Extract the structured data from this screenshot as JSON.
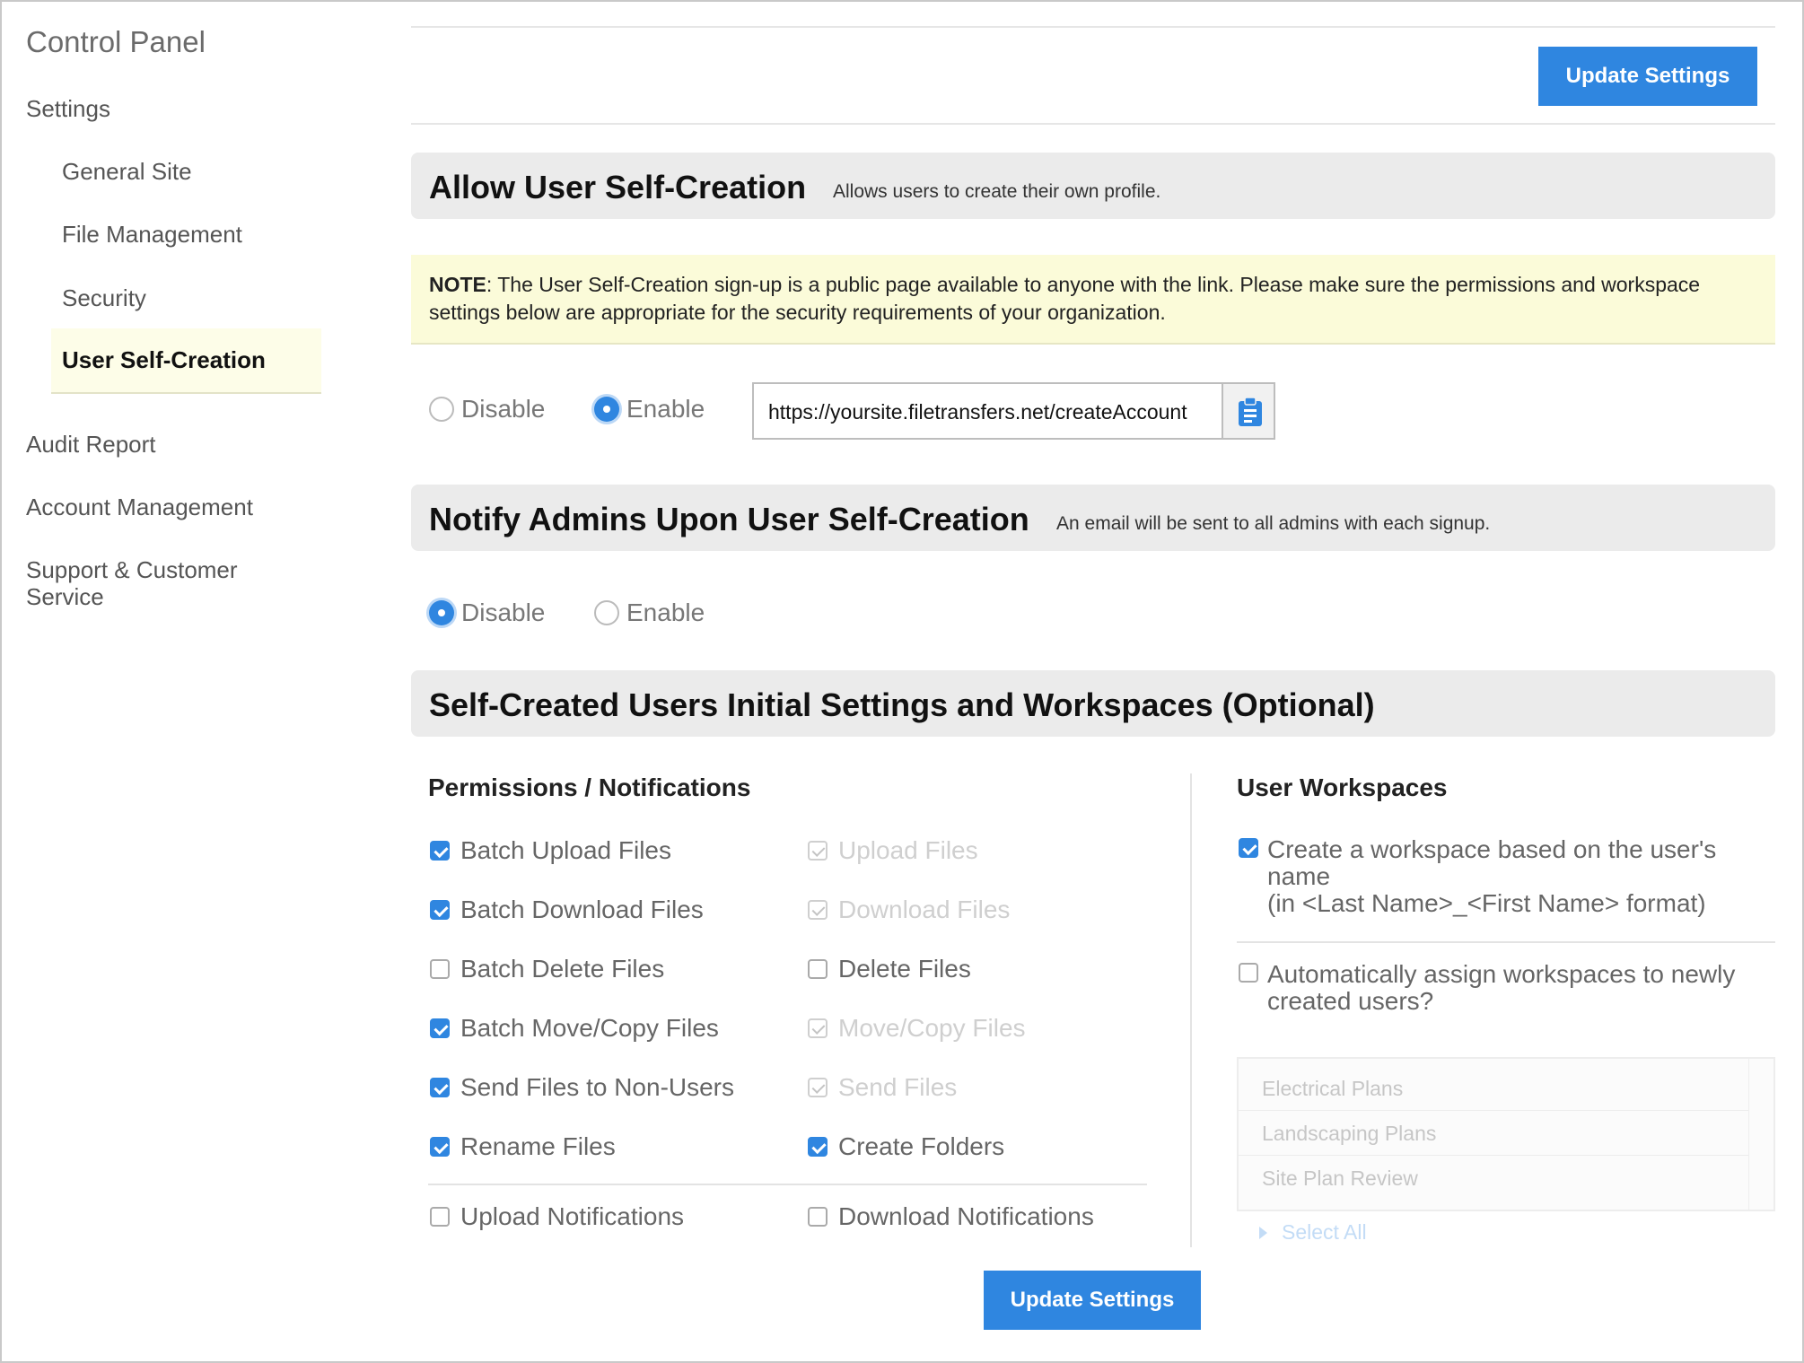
{
  "sidebar": {
    "title": "Control Panel",
    "settings_label": "Settings",
    "sub_items": [
      "General Site",
      "File Management",
      "Security",
      "User Self-Creation"
    ],
    "items": [
      "Audit Report",
      "Account Management",
      "Support & Customer Service"
    ]
  },
  "toolbar": {
    "update_label": "Update Settings"
  },
  "allow_section": {
    "title": "Allow User Self-Creation",
    "description": "Allows users to create their own profile.",
    "note_label": "NOTE",
    "note_text": ": The User Self-Creation sign-up is a public page available to anyone with the link. Please make sure the permissions and workspace settings below are appropriate for the security requirements of your organization.",
    "disable_label": "Disable",
    "enable_label": "Enable",
    "selected": "Enable",
    "url_value": "https://yoursite.filetransfers.net/createAccount"
  },
  "notify_section": {
    "title": "Notify Admins Upon User Self-Creation",
    "description": "An email will be sent to all admins with each signup.",
    "disable_label": "Disable",
    "enable_label": "Enable",
    "selected": "Disable"
  },
  "initial_section": {
    "title": "Self-Created Users Initial Settings and Workspaces (Optional)",
    "permissions_heading": "Permissions / Notifications",
    "permissions_left": [
      {
        "label": "Batch Upload Files",
        "checked": true
      },
      {
        "label": "Batch Download Files",
        "checked": true
      },
      {
        "label": "Batch Delete Files",
        "checked": false
      },
      {
        "label": "Batch Move/Copy Files",
        "checked": true
      },
      {
        "label": "Send Files to Non-Users",
        "checked": true
      },
      {
        "label": "Rename Files",
        "checked": true
      }
    ],
    "permissions_right": [
      {
        "label": "Upload Files",
        "checked": true,
        "disabled": true
      },
      {
        "label": "Download Files",
        "checked": true,
        "disabled": true
      },
      {
        "label": "Delete Files",
        "checked": false,
        "disabled": false
      },
      {
        "label": "Move/Copy Files",
        "checked": true,
        "disabled": true
      },
      {
        "label": "Send Files",
        "checked": true,
        "disabled": true
      },
      {
        "label": "Create Folders",
        "checked": true,
        "disabled": false
      }
    ],
    "notifications": [
      {
        "label": "Upload Notifications",
        "checked": false
      },
      {
        "label": "Download Notifications",
        "checked": false
      }
    ],
    "workspaces_heading": "User Workspaces",
    "ws_option1_line1": "Create a workspace based on the user's",
    "ws_option1_line2": "name",
    "ws_option1_line3": "(in <Last Name>_<First Name> format)",
    "ws_option1_checked": true,
    "ws_option2_line1": "Automatically assign workspaces to newly",
    "ws_option2_line2": "created users?",
    "ws_option2_checked": false,
    "workspaces": [
      "Electrical Plans",
      "Landscaping Plans",
      "Site Plan Review"
    ],
    "select_all_label": "Select All"
  },
  "colors": {
    "accent": "#2f86e0",
    "note_bg": "#fbfbd9",
    "section_bg": "#ebebeb"
  },
  "icons": {
    "copy": "clipboard-icon",
    "select_all": "triangle-right-icon"
  }
}
